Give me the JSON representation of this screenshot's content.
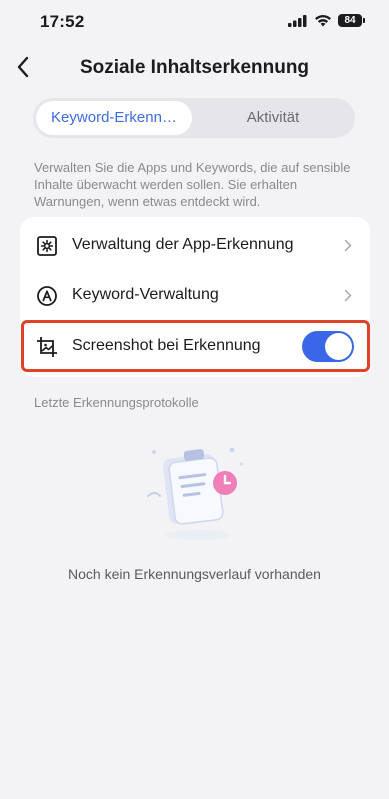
{
  "status_bar": {
    "time": "17:52",
    "battery": "84",
    "icons": [
      "signal-icon",
      "wifi-icon",
      "battery-icon"
    ]
  },
  "nav": {
    "title": "Soziale Inhaltserkennung",
    "back_icon": "chevron-left-icon"
  },
  "tabs": [
    {
      "label": "Keyword-Erkenn…",
      "active": true
    },
    {
      "label": "Aktivität",
      "active": false
    }
  ],
  "description": "Verwalten Sie die Apps und Keywords, die auf sensible Inhalte überwacht werden sollen. Sie erhalten Warnungen, wenn etwas entdeckt wird.",
  "settings": {
    "items": [
      {
        "label": "Verwaltung der App-Erkennung",
        "icon": "app-settings-icon",
        "control": "chevron"
      },
      {
        "label": "Keyword-Verwaltung",
        "icon": "keyword-icon",
        "control": "chevron"
      },
      {
        "label": "Screenshot bei Erkennung",
        "icon": "screenshot-icon",
        "control": "toggle",
        "toggle_on": true
      }
    ]
  },
  "logs": {
    "section_title": "Letzte Erkennungsprotokolle",
    "empty_text": "Noch kein Erkennungsverlauf vorhanden"
  },
  "colors": {
    "accent": "#3a67e8",
    "tab_active_text": "#3e6be0",
    "highlight": "#e0412b",
    "background": "#f3f3f5"
  }
}
